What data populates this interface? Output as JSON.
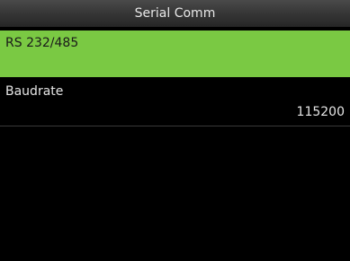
{
  "title": "Serial Comm",
  "items": [
    {
      "label": "RS 232/485",
      "value": "",
      "selected": true
    },
    {
      "label": "Baudrate",
      "value": "115200",
      "selected": false
    }
  ],
  "colors": {
    "background": "#000000",
    "selection": "#7ac943",
    "text": "#e6e6e6",
    "title_text": "#e8e8e8"
  }
}
